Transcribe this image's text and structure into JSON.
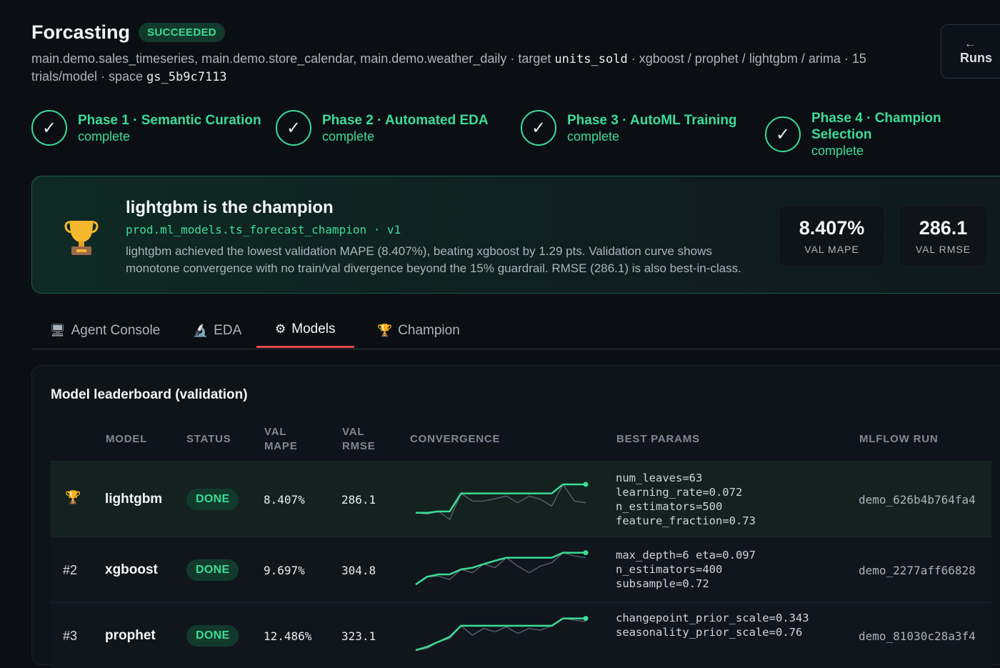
{
  "header": {
    "title": "Forcasting",
    "status_badge": "SUCCEEDED",
    "sub_tables": "main.demo.sales_timeseries, main.demo.store_calendar, main.demo.weather_daily · target ",
    "target": "units_sold",
    "sub_models": " · xgboost / prophet / lightgbm / arima · 15 trials/model · space ",
    "space": "gs_5b9c7113",
    "runs_arrow": "←",
    "runs_label": "Runs"
  },
  "phases": [
    {
      "title": "Phase 1 · Semantic Curation",
      "status": "complete"
    },
    {
      "title": "Phase 2 · Automated EDA",
      "status": "complete"
    },
    {
      "title": "Phase 3 · AutoML Training",
      "status": "complete"
    },
    {
      "title": "Phase 4 · Champion Selection",
      "status": "complete"
    }
  ],
  "champion": {
    "title": "lightgbm is the champion",
    "model_path": "prod.ml_models.ts_forecast_champion · v1",
    "description": "lightgbm achieved the lowest validation MAPE (8.407%), beating xgboost by 1.29 pts. Validation curve shows monotone convergence with no train/val divergence beyond the 15% guardrail. RMSE (286.1) is also best-in-class.",
    "metrics": [
      {
        "value": "8.407%",
        "label": "VAL MAPE"
      },
      {
        "value": "286.1",
        "label": "VAL RMSE"
      }
    ]
  },
  "tabs": [
    {
      "icon": "🖥",
      "label": "Agent Console"
    },
    {
      "icon": "🔬",
      "label": "EDA"
    },
    {
      "icon": "⚙",
      "label": "Models"
    },
    {
      "icon": "🏆",
      "label": "Champion"
    }
  ],
  "leaderboard": {
    "title": "Model leaderboard (validation)",
    "columns": {
      "model": "MODEL",
      "status": "STATUS",
      "val_mape_1": "VAL",
      "val_mape_2": "MAPE",
      "val_rmse_1": "VAL",
      "val_rmse_2": "RMSE",
      "convergence": "CONVERGENCE",
      "best_params": "BEST PARAMS",
      "mlflow_run": "MLFLOW RUN"
    },
    "rows": [
      {
        "rank": "🏆",
        "model": "lightgbm",
        "status": "DONE",
        "val_mape": "8.407%",
        "val_rmse": "286.1",
        "params": "num_leaves=63\nlearning_rate=0.072\nn_estimators=500\nfeature_fraction=0.73",
        "mlflow_run": "demo_626b4b764fa4",
        "best_curve": [
          0.1,
          0.1,
          0.14,
          0.14,
          0.68,
          0.68,
          0.68,
          0.68,
          0.68,
          0.68,
          0.68,
          0.68,
          0.68,
          0.95,
          0.95,
          0.95
        ],
        "trial_curve": [
          0.1,
          0.06,
          0.14,
          -0.1,
          0.68,
          0.45,
          0.45,
          0.52,
          0.6,
          0.4,
          0.6,
          0.5,
          0.3,
          0.95,
          0.45,
          0.4
        ]
      },
      {
        "rank": "#2",
        "model": "xgboost",
        "status": "DONE",
        "val_mape": "9.697%",
        "val_rmse": "304.8",
        "params": "max_depth=6 eta=0.097\nn_estimators=400\nsubsample=0.72",
        "mlflow_run": "demo_2277aff66828",
        "best_curve": [
          0.05,
          0.28,
          0.35,
          0.35,
          0.5,
          0.55,
          0.66,
          0.76,
          0.85,
          0.85,
          0.85,
          0.85,
          0.85,
          1.0,
          1.0,
          1.0
        ],
        "trial_curve": [
          0.05,
          0.28,
          0.3,
          0.2,
          0.5,
          0.4,
          0.66,
          0.55,
          0.85,
          0.6,
          0.4,
          0.6,
          0.7,
          1.0,
          0.9,
          0.85
        ]
      },
      {
        "rank": "#3",
        "model": "prophet",
        "status": "DONE",
        "val_mape": "12.486%",
        "val_rmse": "323.1",
        "params": "changepoint_prior_scale=0.343\nseasonality_prior_scale=0.76",
        "mlflow_run": "demo_81030c28a3f4",
        "best_curve": [
          0.05,
          0.15,
          0.3,
          0.45,
          0.78,
          0.78,
          0.78,
          0.78,
          0.78,
          0.78,
          0.78,
          0.78,
          0.78,
          1.0,
          1.0,
          1.0
        ],
        "trial_curve": [
          0.05,
          0.1,
          0.3,
          0.4,
          0.78,
          0.5,
          0.7,
          0.6,
          0.75,
          0.55,
          0.7,
          0.65,
          0.78,
          1.0,
          0.95,
          0.9
        ]
      }
    ]
  },
  "colors": {
    "accent_green": "#3ddc97",
    "active_tab_underline": "#e5484d",
    "trial_line": "#5b6673"
  }
}
